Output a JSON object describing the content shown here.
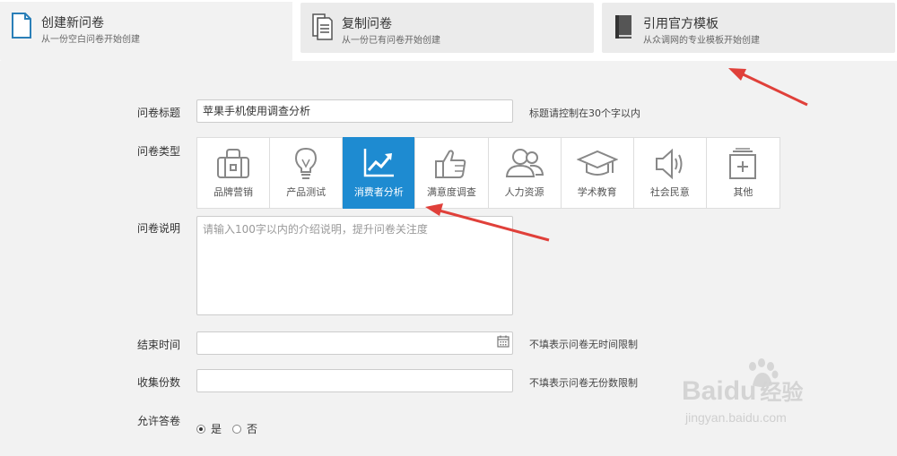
{
  "tabs": [
    {
      "title": "创建新问卷",
      "subtitle": "从一份空白问卷开始创建",
      "icon": "blank-doc-icon"
    },
    {
      "title": "复制问卷",
      "subtitle": "从一份已有问卷开始创建",
      "icon": "copy-doc-icon"
    },
    {
      "title": "引用官方模板",
      "subtitle": "从众调网的专业模板开始创建",
      "icon": "template-book-icon"
    }
  ],
  "form": {
    "title_label": "问卷标题",
    "title_value": "苹果手机使用调查分析",
    "title_hint": "标题请控制在30个字以内",
    "type_label": "问卷类型",
    "types": [
      {
        "label": "品牌营销",
        "icon": "briefcase-icon"
      },
      {
        "label": "产品测试",
        "icon": "lightbulb-icon"
      },
      {
        "label": "消费者分析",
        "icon": "chart-up-icon"
      },
      {
        "label": "满意度调查",
        "icon": "thumbs-up-icon"
      },
      {
        "label": "人力资源",
        "icon": "people-icon"
      },
      {
        "label": "学术教育",
        "icon": "graduation-cap-icon"
      },
      {
        "label": "社会民意",
        "icon": "speaker-icon"
      },
      {
        "label": "其他",
        "icon": "plus-box-icon"
      }
    ],
    "selected_type": "消费者分析",
    "desc_label": "问卷说明",
    "desc_placeholder": "请输入100字以内的介绍说明，提升问卷关注度",
    "end_label": "结束时间",
    "end_value": "",
    "end_hint": "不填表示问卷无时间限制",
    "count_label": "收集份数",
    "count_value": "",
    "count_hint": "不填表示问卷无份数限制",
    "allow_label": "允许答卷",
    "allow_yes": "是",
    "allow_no": "否",
    "allow_selected": "是"
  },
  "colors": {
    "accent": "#1e8bd1",
    "arrow": "#e0403a"
  },
  "watermark": {
    "brand": "Bai",
    "brand2": "du",
    "suffix": "经验",
    "url": "jingyan.baidu.com"
  }
}
